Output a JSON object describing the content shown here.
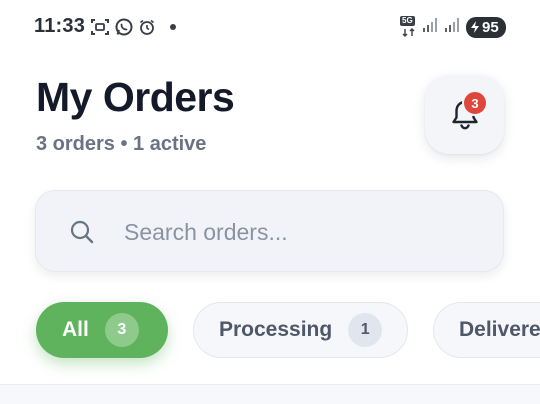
{
  "status_bar": {
    "time": "11:33",
    "network": "5G",
    "battery": "95",
    "icons": [
      "screenshot-icon",
      "whatsapp-icon",
      "alarm-icon",
      "notification-dot",
      "network-5g-icon",
      "signal-icon",
      "signal-icon",
      "battery-icon"
    ]
  },
  "header": {
    "title": "My Orders",
    "subtitle": "3 orders • 1 active",
    "notification_count": "3"
  },
  "search": {
    "placeholder": "Search orders...",
    "value": ""
  },
  "filters": [
    {
      "label": "All",
      "count": "3",
      "selected": true
    },
    {
      "label": "Processing",
      "count": "1",
      "selected": false
    },
    {
      "label": "Delivered",
      "count": "",
      "selected": false
    }
  ],
  "colors": {
    "accent": "#5fb35c",
    "badge": "#e0473b",
    "title": "#141a2a",
    "muted": "#6a7384"
  }
}
